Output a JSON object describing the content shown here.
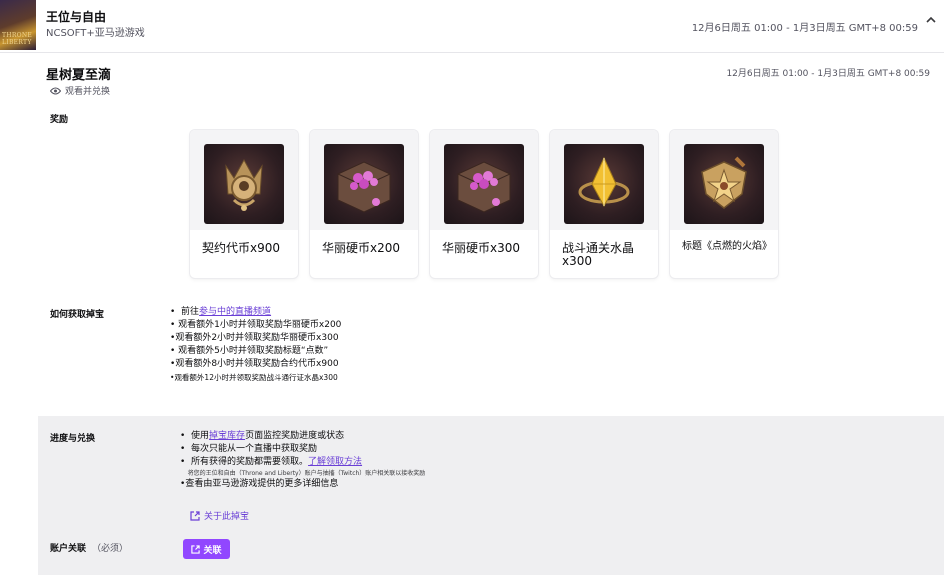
{
  "header": {
    "game_title": "王位与自由",
    "publisher": "NCSOFT+亚马逊游戏",
    "date_range": "12月6日周五 01:00 - 1月3日周五 GMT+8 00:59",
    "cover_logo": "THRONE LIBERTY",
    "collapse_icon": "chevron-up-icon"
  },
  "campaign": {
    "title": "星树夏至滴",
    "date_range": "12月6日周五 01:00 - 1月3日周五 GMT+8 00:59",
    "watch_label": "观看并兑换",
    "watch_icon": "eye-icon"
  },
  "rewards": {
    "label": "奖励",
    "items": [
      {
        "name": "契约代币x900",
        "icon": "emblem-icon"
      },
      {
        "name": "华丽硬币x200",
        "icon": "coin-chest-icon"
      },
      {
        "name": "华丽硬币x300",
        "icon": "coin-chest-icon"
      },
      {
        "name": "战斗通关水晶x300",
        "icon": "crystal-icon"
      },
      {
        "name": "标题《点燃的火焰》",
        "icon": "title-badge-icon"
      }
    ]
  },
  "how_to": {
    "label": "如何获取掉宝",
    "step1_prefix": "前往",
    "step1_link": "参与中的直播频道",
    "steps": [
      "观看额外1小时并领取奖励华丽硬币x200",
      "观看额外2小时并领取奖励华丽硬币x300",
      "观看额外5小时并领取奖励标题“点数”",
      "观看额外8小时并领取奖励合约代币x900",
      "观看额外12小时并领取奖励战斗通行证水晶x300"
    ]
  },
  "progress": {
    "label": "进度与兑换",
    "item1_prefix": "使用",
    "item1_link": "掉宝库存",
    "item1_suffix": "页面监控奖励进度或状态",
    "item2": "每次只能从一个直播中获取奖励",
    "item3_prefix": "所有获得的奖励都需要领取。",
    "item3_link": "了解领取方法",
    "item4_fine": "将您的王位和自由（Throne and Liberty）账户与抽搐（Twitch）账户相关联以接收奖励",
    "item5": "查看由亚马逊游戏提供的更多详细信息",
    "about_link": "关于此掉宝",
    "about_icon": "external-link-icon"
  },
  "account": {
    "label": "账户关联",
    "required": "（必须）",
    "button_label": "关联",
    "button_icon": "external-link-icon"
  },
  "colors": {
    "accent": "#9147ff",
    "link": "#6a3fd6",
    "panel_bg": "#efeff1"
  }
}
